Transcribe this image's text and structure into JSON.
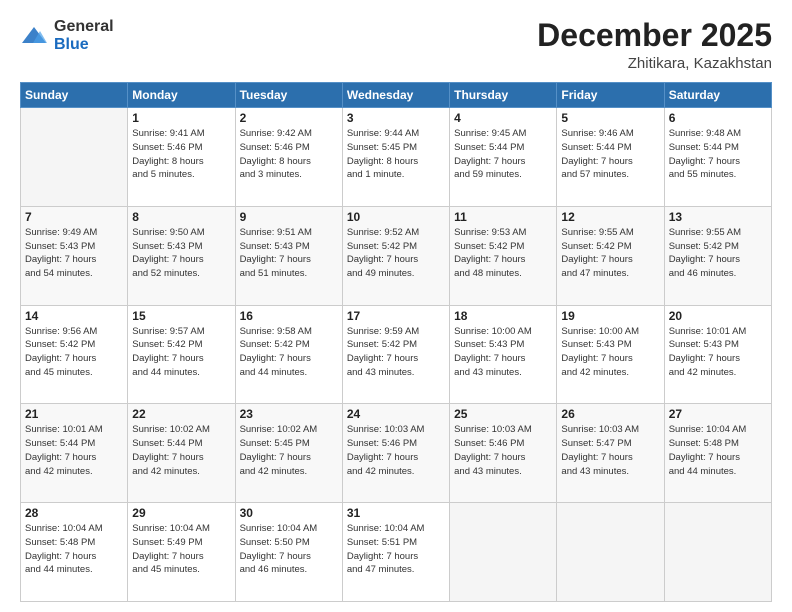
{
  "header": {
    "logo_general": "General",
    "logo_blue": "Blue",
    "month_title": "December 2025",
    "location": "Zhitikara, Kazakhstan"
  },
  "days_of_week": [
    "Sunday",
    "Monday",
    "Tuesday",
    "Wednesday",
    "Thursday",
    "Friday",
    "Saturday"
  ],
  "weeks": [
    [
      {
        "day": "",
        "info": ""
      },
      {
        "day": "1",
        "info": "Sunrise: 9:41 AM\nSunset: 5:46 PM\nDaylight: 8 hours\nand 5 minutes."
      },
      {
        "day": "2",
        "info": "Sunrise: 9:42 AM\nSunset: 5:46 PM\nDaylight: 8 hours\nand 3 minutes."
      },
      {
        "day": "3",
        "info": "Sunrise: 9:44 AM\nSunset: 5:45 PM\nDaylight: 8 hours\nand 1 minute."
      },
      {
        "day": "4",
        "info": "Sunrise: 9:45 AM\nSunset: 5:44 PM\nDaylight: 7 hours\nand 59 minutes."
      },
      {
        "day": "5",
        "info": "Sunrise: 9:46 AM\nSunset: 5:44 PM\nDaylight: 7 hours\nand 57 minutes."
      },
      {
        "day": "6",
        "info": "Sunrise: 9:48 AM\nSunset: 5:44 PM\nDaylight: 7 hours\nand 55 minutes."
      }
    ],
    [
      {
        "day": "7",
        "info": "Sunrise: 9:49 AM\nSunset: 5:43 PM\nDaylight: 7 hours\nand 54 minutes."
      },
      {
        "day": "8",
        "info": "Sunrise: 9:50 AM\nSunset: 5:43 PM\nDaylight: 7 hours\nand 52 minutes."
      },
      {
        "day": "9",
        "info": "Sunrise: 9:51 AM\nSunset: 5:43 PM\nDaylight: 7 hours\nand 51 minutes."
      },
      {
        "day": "10",
        "info": "Sunrise: 9:52 AM\nSunset: 5:42 PM\nDaylight: 7 hours\nand 49 minutes."
      },
      {
        "day": "11",
        "info": "Sunrise: 9:53 AM\nSunset: 5:42 PM\nDaylight: 7 hours\nand 48 minutes."
      },
      {
        "day": "12",
        "info": "Sunrise: 9:55 AM\nSunset: 5:42 PM\nDaylight: 7 hours\nand 47 minutes."
      },
      {
        "day": "13",
        "info": "Sunrise: 9:55 AM\nSunset: 5:42 PM\nDaylight: 7 hours\nand 46 minutes."
      }
    ],
    [
      {
        "day": "14",
        "info": "Sunrise: 9:56 AM\nSunset: 5:42 PM\nDaylight: 7 hours\nand 45 minutes."
      },
      {
        "day": "15",
        "info": "Sunrise: 9:57 AM\nSunset: 5:42 PM\nDaylight: 7 hours\nand 44 minutes."
      },
      {
        "day": "16",
        "info": "Sunrise: 9:58 AM\nSunset: 5:42 PM\nDaylight: 7 hours\nand 44 minutes."
      },
      {
        "day": "17",
        "info": "Sunrise: 9:59 AM\nSunset: 5:42 PM\nDaylight: 7 hours\nand 43 minutes."
      },
      {
        "day": "18",
        "info": "Sunrise: 10:00 AM\nSunset: 5:43 PM\nDaylight: 7 hours\nand 43 minutes."
      },
      {
        "day": "19",
        "info": "Sunrise: 10:00 AM\nSunset: 5:43 PM\nDaylight: 7 hours\nand 42 minutes."
      },
      {
        "day": "20",
        "info": "Sunrise: 10:01 AM\nSunset: 5:43 PM\nDaylight: 7 hours\nand 42 minutes."
      }
    ],
    [
      {
        "day": "21",
        "info": "Sunrise: 10:01 AM\nSunset: 5:44 PM\nDaylight: 7 hours\nand 42 minutes."
      },
      {
        "day": "22",
        "info": "Sunrise: 10:02 AM\nSunset: 5:44 PM\nDaylight: 7 hours\nand 42 minutes."
      },
      {
        "day": "23",
        "info": "Sunrise: 10:02 AM\nSunset: 5:45 PM\nDaylight: 7 hours\nand 42 minutes."
      },
      {
        "day": "24",
        "info": "Sunrise: 10:03 AM\nSunset: 5:46 PM\nDaylight: 7 hours\nand 42 minutes."
      },
      {
        "day": "25",
        "info": "Sunrise: 10:03 AM\nSunset: 5:46 PM\nDaylight: 7 hours\nand 43 minutes."
      },
      {
        "day": "26",
        "info": "Sunrise: 10:03 AM\nSunset: 5:47 PM\nDaylight: 7 hours\nand 43 minutes."
      },
      {
        "day": "27",
        "info": "Sunrise: 10:04 AM\nSunset: 5:48 PM\nDaylight: 7 hours\nand 44 minutes."
      }
    ],
    [
      {
        "day": "28",
        "info": "Sunrise: 10:04 AM\nSunset: 5:48 PM\nDaylight: 7 hours\nand 44 minutes."
      },
      {
        "day": "29",
        "info": "Sunrise: 10:04 AM\nSunset: 5:49 PM\nDaylight: 7 hours\nand 45 minutes."
      },
      {
        "day": "30",
        "info": "Sunrise: 10:04 AM\nSunset: 5:50 PM\nDaylight: 7 hours\nand 46 minutes."
      },
      {
        "day": "31",
        "info": "Sunrise: 10:04 AM\nSunset: 5:51 PM\nDaylight: 7 hours\nand 47 minutes."
      },
      {
        "day": "",
        "info": ""
      },
      {
        "day": "",
        "info": ""
      },
      {
        "day": "",
        "info": ""
      }
    ]
  ]
}
